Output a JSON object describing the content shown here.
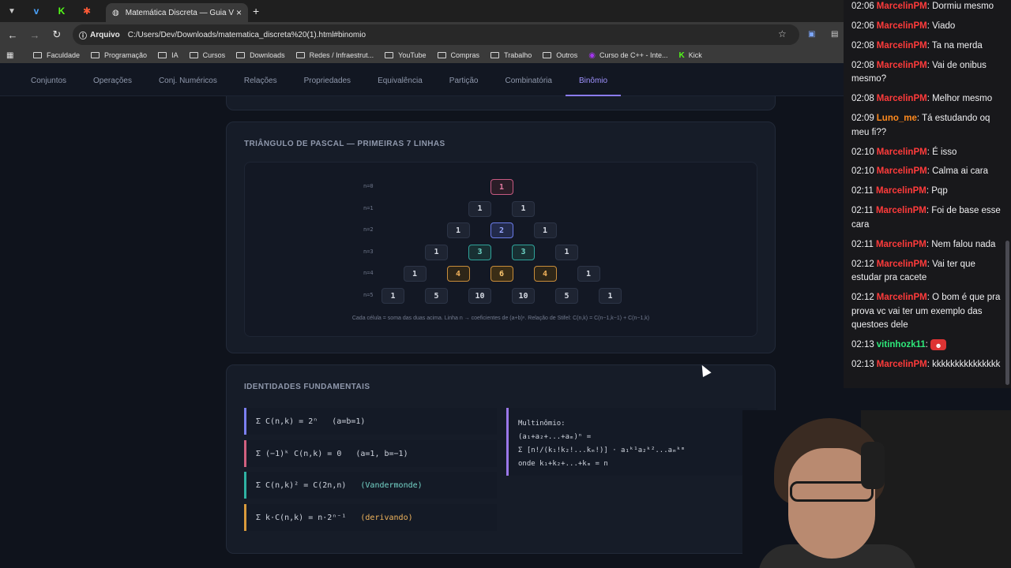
{
  "browser": {
    "tab_title": "Matemática Discreta — Guia V",
    "omnibox_chip": "Arquivo",
    "url": "C:/Users/Dev/Downloads/matematica_discreta%20(1).html#binomio",
    "bookmarks": [
      "Faculdade",
      "Programação",
      "IA",
      "Cursos",
      "Downloads",
      "Redes / Infraestrut...",
      "YouTube",
      "Compras",
      "Trabalho",
      "Outros",
      "Curso de C++ - Inte...",
      "Kick"
    ]
  },
  "nav": {
    "items": [
      "Conjuntos",
      "Operações",
      "Conj. Numéricos",
      "Relações",
      "Propriedades",
      "Equivalência",
      "Partição",
      "Combinatória",
      "Binômio"
    ],
    "active": "Binômio"
  },
  "pascal": {
    "title": "TRIÂNGULO DE PASCAL — PRIMEIRAS 7 LINHAS",
    "rows": [
      {
        "label": "n=0",
        "values": [
          "1"
        ],
        "colors": [
          "pink"
        ]
      },
      {
        "label": "n=1",
        "values": [
          "1",
          "1"
        ],
        "colors": [
          "",
          ""
        ]
      },
      {
        "label": "n=2",
        "values": [
          "1",
          "2",
          "1"
        ],
        "colors": [
          "",
          "blue",
          ""
        ]
      },
      {
        "label": "n=3",
        "values": [
          "1",
          "3",
          "3",
          "1"
        ],
        "colors": [
          "",
          "teal",
          "teal",
          ""
        ]
      },
      {
        "label": "n=4",
        "values": [
          "1",
          "4",
          "6",
          "4",
          "1"
        ],
        "colors": [
          "",
          "amber",
          "amber strong",
          "amber",
          ""
        ]
      },
      {
        "label": "n=5",
        "values": [
          "1",
          "5",
          "10",
          "10",
          "5",
          "1"
        ],
        "colors": [
          "",
          "",
          "",
          "",
          "",
          ""
        ]
      }
    ],
    "note": "Cada célula = soma das duas acima. Linha n → coeficientes de (a+b)ⁿ. Relação de Stifel: C(n,k) = C(n−1,k−1) + C(n−1,k)"
  },
  "identities": {
    "title": "IDENTIDADES FUNDAMENTAIS",
    "items": [
      {
        "formula": "Σ C(n,k) = 2ⁿ",
        "note": "(a=b=1)",
        "color": "blue"
      },
      {
        "formula": "Σ (−1)ᵏ C(n,k) = 0",
        "note": "(a=1, b=−1)",
        "color": "pink"
      },
      {
        "formula": "Σ C(n,k)² = C(2n,n)",
        "note": "(Vandermonde)",
        "color": "teal"
      },
      {
        "formula": "Σ k·C(n,k) = n·2ⁿ⁻¹",
        "note": "(derivando)",
        "color": "amber"
      }
    ],
    "multinomial": [
      "Multinômio:",
      "(a₁+a₂+...+aₘ)ⁿ =",
      "Σ [n!/(k₁!k₂!...kₘ!)] · a₁ᵏ¹a₂ᵏ²...aₘᵏᵐ",
      "onde k₁+k₂+...+kₘ = n"
    ]
  },
  "chat": [
    {
      "time": "02:06",
      "user": "MarcelinPM",
      "color": "#ff3b3b",
      "text": "Dormiu mesmo"
    },
    {
      "time": "02:06",
      "user": "MarcelinPM",
      "color": "#ff3b3b",
      "text": "Viado"
    },
    {
      "time": "02:08",
      "user": "MarcelinPM",
      "color": "#ff3b3b",
      "text": "Ta na merda"
    },
    {
      "time": "02:08",
      "user": "MarcelinPM",
      "color": "#ff3b3b",
      "text": "Vai de onibus mesmo?"
    },
    {
      "time": "02:08",
      "user": "MarcelinPM",
      "color": "#ff3b3b",
      "text": "Melhor mesmo"
    },
    {
      "time": "02:09",
      "user": "Luno_me",
      "color": "#ff8a1e",
      "text": "Tá estudando oq meu fi??"
    },
    {
      "time": "02:10",
      "user": "MarcelinPM",
      "color": "#ff3b3b",
      "text": "É isso"
    },
    {
      "time": "02:10",
      "user": "MarcelinPM",
      "color": "#ff3b3b",
      "text": "Calma ai cara"
    },
    {
      "time": "02:11",
      "user": "MarcelinPM",
      "color": "#ff3b3b",
      "text": "Pqp"
    },
    {
      "time": "02:11",
      "user": "MarcelinPM",
      "color": "#ff3b3b",
      "text": "Foi de base esse cara"
    },
    {
      "time": "02:11",
      "user": "MarcelinPM",
      "color": "#ff3b3b",
      "text": "Nem falou nada"
    },
    {
      "time": "02:12",
      "user": "MarcelinPM",
      "color": "#ff3b3b",
      "text": "Vai ter que estudar pra cacete"
    },
    {
      "time": "02:12",
      "user": "MarcelinPM",
      "color": "#ff3b3b",
      "text": "O bom é que pra prova vc vai ter um exemplo das questoes dele"
    },
    {
      "time": "02:13",
      "user": "vitinhozk11",
      "color": "#2ee87a",
      "text": "",
      "emote": true
    },
    {
      "time": "02:13",
      "user": "MarcelinPM",
      "color": "#ff3b3b",
      "text": "kkkkkkkkkkkkkkk"
    }
  ]
}
